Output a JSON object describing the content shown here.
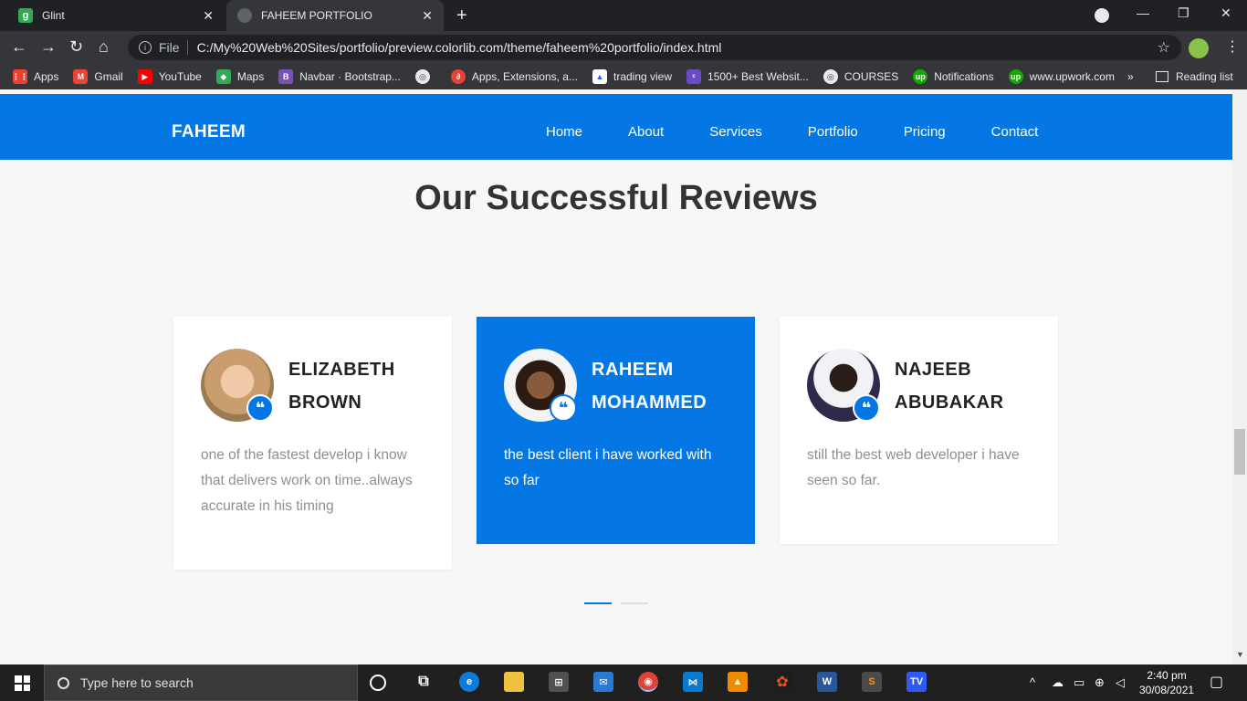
{
  "browser": {
    "tabs": [
      {
        "title": "Glint",
        "favicon": "g",
        "active": false
      },
      {
        "title": "FAHEEM PORTFOLIO",
        "active": true
      }
    ],
    "address": {
      "scheme_label": "File",
      "url": "C:/My%20Web%20Sites/portfolio/preview.colorlib.com/theme/faheem%20portfolio/index.html"
    },
    "bookmarks": [
      {
        "label": "Apps",
        "icon": "apps-grid-icon",
        "color": "#e94235"
      },
      {
        "label": "Gmail",
        "icon": "gmail-icon",
        "color": "#ea4335"
      },
      {
        "label": "YouTube",
        "icon": "youtube-icon",
        "color": "#ff0000"
      },
      {
        "label": "Maps",
        "icon": "maps-icon",
        "color": "#34a853"
      },
      {
        "label": "Navbar · Bootstrap...",
        "icon": "bootstrap-icon",
        "color": "#7952b3"
      },
      {
        "label": "",
        "icon": "globe-icon",
        "color": "#e8eaed"
      },
      {
        "label": "Apps, Extensions, a...",
        "icon": "extensions-icon",
        "color": "#e94235"
      },
      {
        "label": "trading view",
        "icon": "tradingview-icon",
        "color": "#ffffff"
      },
      {
        "label": "1500+ Best Websit...",
        "icon": "colorlib-icon",
        "color": "#6a4bc4"
      },
      {
        "label": "COURSES",
        "icon": "globe-icon",
        "color": "#e8eaed"
      },
      {
        "label": "Notifications",
        "icon": "upwork-icon",
        "color": "#14a800"
      },
      {
        "label": "www.upwork.com",
        "icon": "upwork-icon",
        "color": "#14a800"
      }
    ],
    "bookmarks_more": "»",
    "reading_list": "Reading list"
  },
  "site": {
    "brand": "FAHEEM",
    "nav": [
      "Home",
      "About",
      "Services",
      "Portfolio",
      "Pricing",
      "Contact"
    ],
    "accent_color": "#0477e4",
    "section_title": "Our Successful Reviews",
    "reviews": [
      {
        "name_line1": "ELIZABETH",
        "name_line2": "BROWN",
        "text": "one of the fastest develop i know that delivers work on time..always accurate in his timing",
        "highlighted": false
      },
      {
        "name_line1": "RAHEEM",
        "name_line2": "MOHAMMED",
        "text": "the best client i have worked with so far",
        "highlighted": true
      },
      {
        "name_line1": "NAJEEB",
        "name_line2": "ABUBAKAR",
        "text": "still the best web developer i have seen so far.",
        "highlighted": false
      }
    ],
    "quote_glyph": "❝",
    "carousel": {
      "pages": 2,
      "active": 0
    }
  },
  "taskbar": {
    "search_placeholder": "Type here to search",
    "time": "2:40 pm",
    "date": "30/08/2021"
  }
}
